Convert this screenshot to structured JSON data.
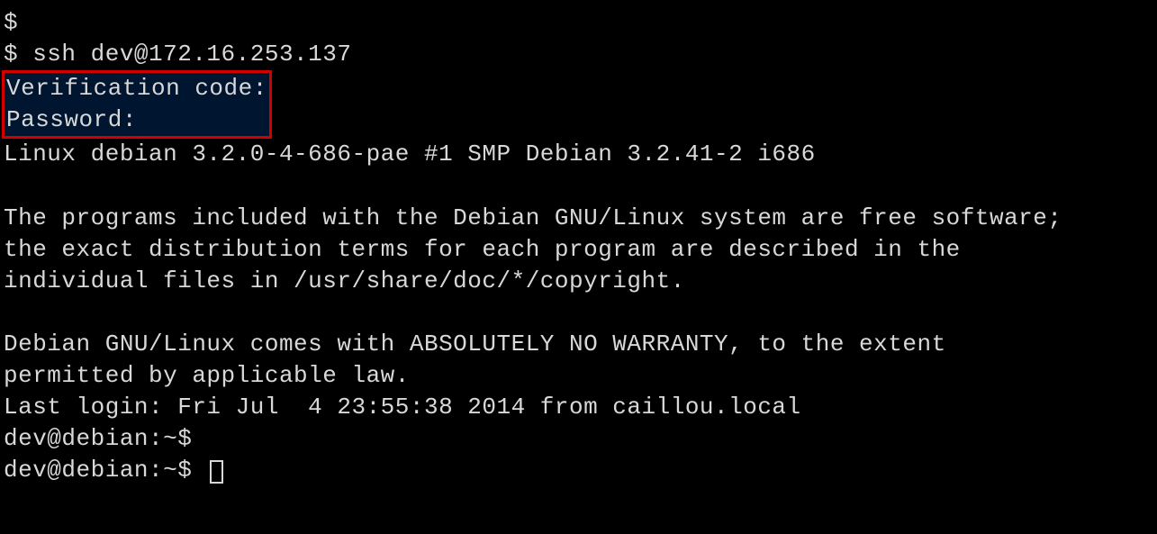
{
  "prompt1": "$",
  "prompt2": "$ ssh dev@172.16.253.137",
  "verification": "Verification code:",
  "password": "Password:",
  "kernel": "Linux debian 3.2.0-4-686-pae #1 SMP Debian 3.2.41-2 i686",
  "motd1": "The programs included with the Debian GNU/Linux system are free software;",
  "motd2": "the exact distribution terms for each program are described in the",
  "motd3": "individual files in /usr/share/doc/*/copyright.",
  "motd4": "Debian GNU/Linux comes with ABSOLUTELY NO WARRANTY, to the extent",
  "motd5": "permitted by applicable law.",
  "lastlogin": "Last login: Fri Jul  4 23:55:38 2014 from caillou.local",
  "shell1": "dev@debian:~$",
  "shell2": "dev@debian:~$ "
}
